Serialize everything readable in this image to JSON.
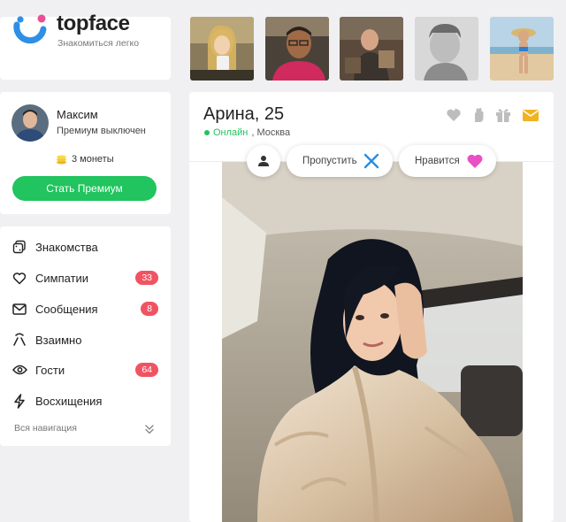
{
  "brand": {
    "name": "topface",
    "tagline": "Знакомиться легко",
    "colors": {
      "blue": "#2e8fe6",
      "pink": "#ea4f95"
    }
  },
  "photo_strip": {
    "items": [
      {
        "icon": "user-photo-1"
      },
      {
        "icon": "user-photo-2"
      },
      {
        "icon": "user-photo-3"
      },
      {
        "icon": "user-photo-4"
      },
      {
        "icon": "user-photo-5"
      }
    ]
  },
  "user": {
    "name": "Максим",
    "status": "Премиум выключен",
    "coins": "3 монеты",
    "premium_button": "Стать Премиум"
  },
  "nav": {
    "items": [
      {
        "label": "Знакомства",
        "icon": "dating-icon",
        "badge": ""
      },
      {
        "label": "Симпатии",
        "icon": "heart-icon",
        "badge": "33"
      },
      {
        "label": "Сообщения",
        "icon": "envelope-icon",
        "badge": "8"
      },
      {
        "label": "Взаимно",
        "icon": "mutual-icon",
        "badge": ""
      },
      {
        "label": "Гости",
        "icon": "eye-icon",
        "badge": "64"
      },
      {
        "label": "Восхищения",
        "icon": "lightning-icon",
        "badge": ""
      }
    ],
    "all_label": "Вся навигация"
  },
  "profile": {
    "name": "Арина, 25",
    "online": "Онлайн",
    "city": ", Москва",
    "actions": [
      "heart-gift-icon",
      "hand-icon",
      "gift-icon",
      "mail-icon"
    ],
    "skip_label": "Пропустить",
    "like_label": "Нравится",
    "colors": {
      "online": "#22c25d",
      "like": "#ea4fc4",
      "skip": "#2b8de3",
      "mail": "#f0b323"
    }
  }
}
